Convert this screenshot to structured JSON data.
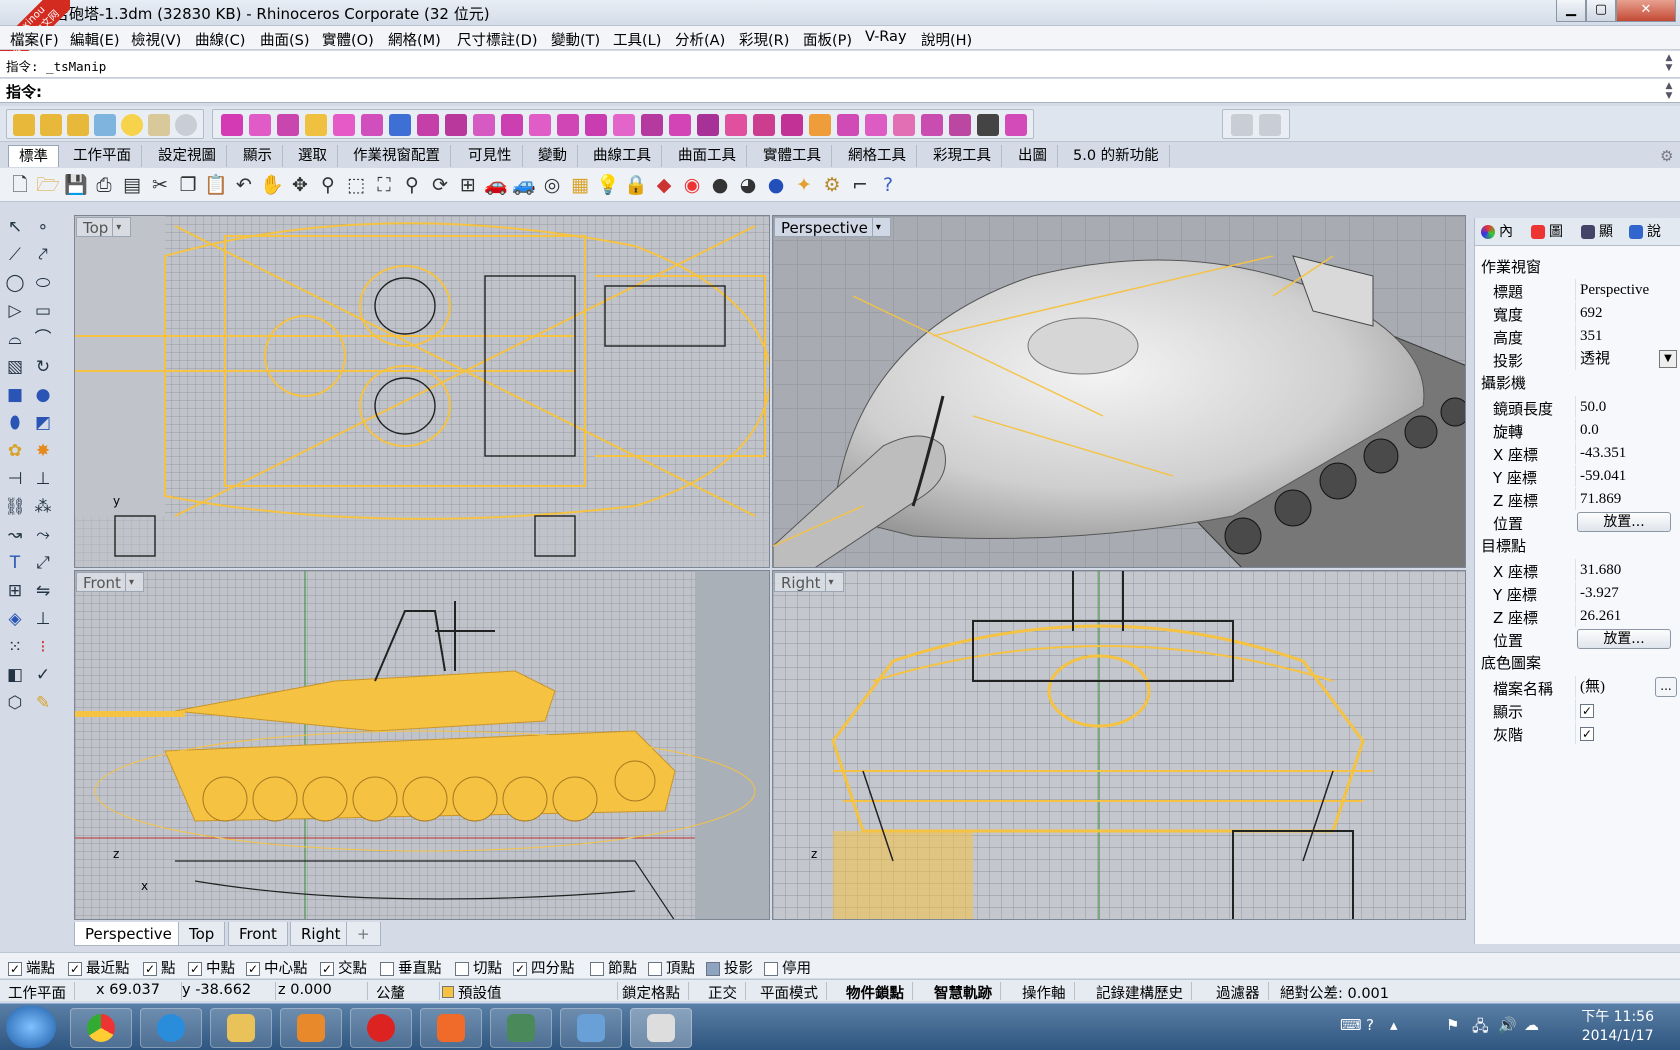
{
  "window": {
    "title": "吉砲塔-1.3dm (32830 KB) - Rhinoceros Corporate (32 位元)",
    "minimize": "▁",
    "maximize": "▢",
    "close": "✕"
  },
  "watermark": {
    "text1": "xuexinou",
    "text2": "学犀牛中文网"
  },
  "menu": [
    "檔案(F)",
    "編輯(E)",
    "檢視(V)",
    "曲線(C)",
    "曲面(S)",
    "實體(O)",
    "網格(M)",
    "尺寸標註(D)",
    "變動(T)",
    "工具(L)",
    "分析(A)",
    "彩現(R)",
    "面板(P)",
    "V-Ray",
    "說明(H)"
  ],
  "command": {
    "history": "指令: _tsManip",
    "prompt_label": "指令:",
    "input_value": ""
  },
  "tabs": [
    "標準",
    "工作平面",
    "設定視圖",
    "顯示",
    "選取",
    "作業視窗配置",
    "可見性",
    "變動",
    "曲線工具",
    "曲面工具",
    "實體工具",
    "網格工具",
    "彩現工具",
    "出圖",
    "5.0 的新功能"
  ],
  "active_tab": "標準",
  "viewports": {
    "top": {
      "label": "Top",
      "axis_y": "y"
    },
    "perspective": {
      "label": "Perspective"
    },
    "front": {
      "label": "Front",
      "axis_z": "z",
      "axis_x": "x"
    },
    "right": {
      "label": "Right",
      "axis_z": "z"
    }
  },
  "viewport_tabs": [
    "Perspective",
    "Top",
    "Front",
    "Right",
    "+"
  ],
  "active_viewport_tab": "Perspective",
  "panel": {
    "tabs": [
      "內",
      "圖",
      "顯",
      "說"
    ],
    "section_viewport": "作業視窗",
    "title_k": "標題",
    "title_v": "Perspective",
    "width_k": "寬度",
    "width_v": "692",
    "height_k": "高度",
    "height_v": "351",
    "projection_k": "投影",
    "projection_v": "透視",
    "section_camera": "攝影機",
    "lens_k": "鏡頭長度",
    "lens_v": "50.0",
    "rot_k": "旋轉",
    "rot_v": "0.0",
    "cx_k": "X 座標",
    "cx_v": "-43.351",
    "cy_k": "Y 座標",
    "cy_v": "-59.041",
    "cz_k": "Z 座標",
    "cz_v": "71.869",
    "cpos_k": "位置",
    "cpos_btn": "放置...",
    "section_target": "目標點",
    "tx_k": "X 座標",
    "tx_v": "31.680",
    "ty_k": "Y 座標",
    "ty_v": "-3.927",
    "tz_k": "Z 座標",
    "tz_v": "26.261",
    "tpos_k": "位置",
    "tpos_btn": "放置...",
    "section_bg": "底色圖案",
    "file_k": "檔案名稱",
    "file_v": "(無)",
    "file_btn": "...",
    "show_k": "顯示",
    "gray_k": "灰階"
  },
  "osnaps": [
    {
      "label": "端點",
      "checked": true
    },
    {
      "label": "最近點",
      "checked": true
    },
    {
      "label": "點",
      "checked": true
    },
    {
      "label": "中點",
      "checked": true
    },
    {
      "label": "中心點",
      "checked": true
    },
    {
      "label": "交點",
      "checked": true
    },
    {
      "label": "垂直點",
      "checked": false
    },
    {
      "label": "切點",
      "checked": false
    },
    {
      "label": "四分點",
      "checked": true
    },
    {
      "label": "節點",
      "checked": false
    },
    {
      "label": "頂點",
      "checked": false
    },
    {
      "label": "投影",
      "checked": false
    },
    {
      "label": "停用",
      "checked": false
    }
  ],
  "status": {
    "cplane": "工作平面",
    "x": "x 69.037",
    "y": "y -38.662",
    "z": "z 0.000",
    "units": "公釐",
    "layer": "預設值",
    "grid_snap": "鎖定格點",
    "ortho": "正交",
    "planar": "平面模式",
    "osnap": "物件鎖點",
    "smarttrack": "智慧軌跡",
    "gumball": "操作軸",
    "history": "記錄建構歷史",
    "filter": "過濾器",
    "tolerance": "絕對公差: 0.001"
  },
  "clock": {
    "time": "下午 11:56",
    "date": "2014/1/17"
  },
  "colors": {
    "wire": "#f5c242",
    "bg_vp": "#bfc4cb",
    "persp_bg": "#a9adb3"
  }
}
